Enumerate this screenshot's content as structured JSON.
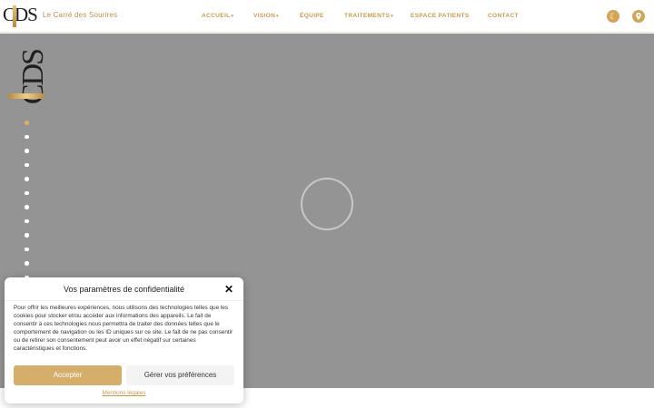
{
  "header": {
    "logo_mark": "CDS",
    "logo_text": "Le Carré des Sourires",
    "nav": {
      "accueil": "ACCUEIL",
      "vision": "VISION",
      "equipe": "ÉQUIPE",
      "traitements": "TRAITEMENTS",
      "espace_patients": "ESPACE PATIENTS",
      "contact": "CONTACT"
    },
    "dropdown_caret": "▾",
    "moon_icon_glyph": "☾",
    "location_icon_glyph": "⬤"
  },
  "hero": {
    "logo_mark": "CDS",
    "slide_dots": [
      {
        "active": true
      },
      {
        "active": false
      },
      {
        "active": false
      },
      {
        "active": false
      },
      {
        "active": false
      },
      {
        "active": false
      },
      {
        "active": false
      },
      {
        "active": false
      },
      {
        "active": false
      },
      {
        "active": false
      },
      {
        "active": false
      },
      {
        "active": false
      }
    ]
  },
  "cookie": {
    "title": "Vos paramètres de confidentialité",
    "close_glyph": "✕",
    "body": "Pour offrir les meilleures expériences, nous utilisons des technologies telles que les cookies pour stocker et/ou accéder aux informations des appareils. Le fait de consentir à ces technologies nous permettra de traiter des données telles que le comportement de navigation ou les ID uniques sur ce site. Le fait de ne pas consentir ou de retirer son consentement peut avoir un effet négatif sur certaines caractéristiques et fonctions.",
    "accept_label": "Accepter",
    "preferences_label": "Gérer vos préférences",
    "legal_link": "Mentions légales"
  },
  "colors": {
    "gold": "#c79b52",
    "hero_bg": "#949494"
  }
}
